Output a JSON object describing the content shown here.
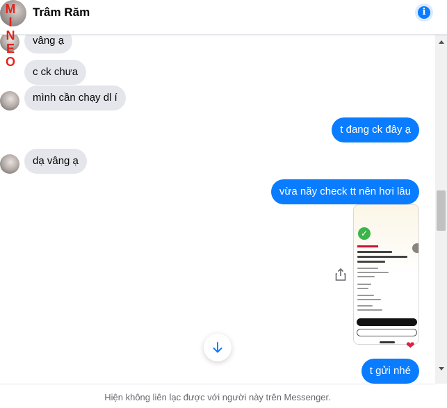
{
  "header": {
    "contact_name": "Trâm Răm",
    "info_icon": "info-icon"
  },
  "watermark": {
    "text": "MINEO",
    "color": "#e2231a"
  },
  "messages": [
    {
      "direction": "incoming",
      "text": "vâng ạ"
    },
    {
      "direction": "incoming",
      "text": "c ck chưa"
    },
    {
      "direction": "incoming",
      "text": "mình cần chạy dl í"
    },
    {
      "direction": "outgoing",
      "text": "t đang ck đây ạ"
    },
    {
      "direction": "incoming",
      "text": "dạ vâng ạ"
    },
    {
      "direction": "outgoing",
      "text": "vừa nãy check tt nên hơi lâu"
    },
    {
      "direction": "outgoing",
      "text": "t gửi nhé"
    }
  ],
  "attachment": {
    "type": "image",
    "description_icon": "transfer-receipt-image",
    "reaction": "❤"
  },
  "controls": {
    "share_icon": "share-icon",
    "scroll_down_icon": "arrow-down-icon"
  },
  "footer": {
    "notice": "Hiện không liên lạc được với người này trên Messenger."
  },
  "colors": {
    "outgoing_bubble": "#0a7cff",
    "incoming_bubble": "#e4e6eb",
    "accent": "#0a7cff"
  }
}
